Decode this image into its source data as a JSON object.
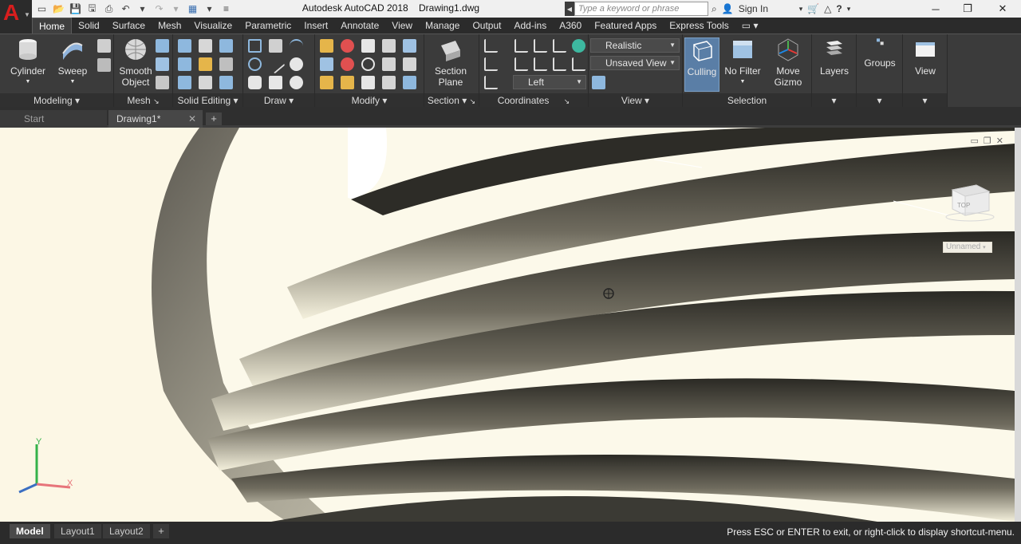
{
  "app": {
    "title": "Autodesk AutoCAD 2018    Drawing1.dwg",
    "logo_letter": "A",
    "search_placeholder": "Type a keyword or phrase",
    "sign_in": "Sign In"
  },
  "tabs": [
    "Home",
    "Solid",
    "Surface",
    "Mesh",
    "Visualize",
    "Parametric",
    "Insert",
    "Annotate",
    "View",
    "Manage",
    "Output",
    "Add-ins",
    "A360",
    "Featured Apps",
    "Express Tools"
  ],
  "ribbon": {
    "cylinder": "Cylinder",
    "sweep": "Sweep",
    "smooth_object": "Smooth Object",
    "section_plane": "Section Plane",
    "culling": "Culling",
    "no_filter": "No Filter",
    "move_gizmo": "Move Gizmo",
    "layers": "Layers",
    "groups": "Groups",
    "view": "View",
    "visual_style": "Realistic",
    "named_view": "Unsaved View",
    "viewport_view": "Left",
    "panels": {
      "modeling": "Modeling",
      "mesh": "Mesh",
      "solid_editing": "Solid Editing",
      "draw": "Draw",
      "modify": "Modify",
      "section": "Section",
      "coordinates": "Coordinates",
      "view": "View",
      "selection": "Selection"
    }
  },
  "doc_tabs": {
    "start": "Start",
    "active": "Drawing1*"
  },
  "viewport": {
    "viewcube_face": "TOP",
    "ucs_dropdown": "Unnamed",
    "axis_x": "X",
    "axis_y": "Y"
  },
  "layout_tabs": [
    "Model",
    "Layout1",
    "Layout2"
  ],
  "status": {
    "command_prompt": "Press ESC or ENTER to exit, or right-click to display shortcut-menu."
  },
  "colors": {
    "accent": "#5a7ea6",
    "ribbon_bg": "#3b3b3b",
    "model_bg": "#fcf7e5",
    "logo_red": "#d81e1e"
  }
}
